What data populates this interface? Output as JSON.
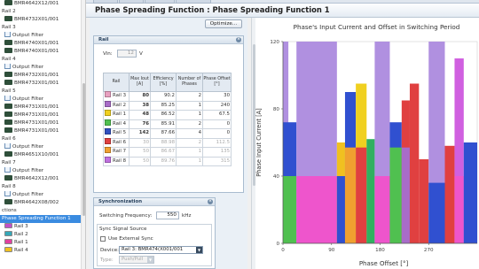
{
  "tree": {
    "items": [
      {
        "label": "BMR4642X12/001",
        "icon": "chip-icon",
        "depth": 1
      },
      {
        "label": "Rail 2",
        "icon": "",
        "depth": 0
      },
      {
        "label": "BMR4732X01/001",
        "icon": "chip-icon",
        "depth": 1
      },
      {
        "label": "Rail 3",
        "icon": "",
        "depth": 0
      },
      {
        "label": "Output Filter",
        "icon": "filter-icon",
        "depth": 1
      },
      {
        "label": "BMR4740X01/001",
        "icon": "chip-icon",
        "depth": 1
      },
      {
        "label": "BMR4740X01/001",
        "icon": "chip-icon",
        "depth": 1
      },
      {
        "label": "Rail 4",
        "icon": "",
        "depth": 0
      },
      {
        "label": "Output Filter",
        "icon": "filter-icon",
        "depth": 1
      },
      {
        "label": "BMR4732X01/001",
        "icon": "chip-icon",
        "depth": 1
      },
      {
        "label": "BMR4732X01/001",
        "icon": "chip-icon",
        "depth": 1
      },
      {
        "label": "Rail 5",
        "icon": "",
        "depth": 0
      },
      {
        "label": "Output Filter",
        "icon": "filter-icon",
        "depth": 1
      },
      {
        "label": "BMR4731X01/001",
        "icon": "chip-icon",
        "depth": 1
      },
      {
        "label": "BMR4731X01/001",
        "icon": "chip-icon",
        "depth": 1
      },
      {
        "label": "BMR4731X01/001",
        "icon": "chip-icon",
        "depth": 1
      },
      {
        "label": "BMR4731X01/001",
        "icon": "chip-icon",
        "depth": 1
      },
      {
        "label": "Rail 6",
        "icon": "",
        "depth": 0
      },
      {
        "label": "Output Filter",
        "icon": "filter-icon",
        "depth": 1
      },
      {
        "label": "BMR4651X10/001",
        "icon": "chip-icon",
        "depth": 1
      },
      {
        "label": "Rail 7",
        "icon": "",
        "depth": 0
      },
      {
        "label": "Output Filter",
        "icon": "filter-icon",
        "depth": 1
      },
      {
        "label": "BMR4642X12/001",
        "icon": "chip-icon",
        "depth": 1
      },
      {
        "label": "Rail 8",
        "icon": "",
        "depth": 0
      },
      {
        "label": "Output Filter",
        "icon": "filter-icon",
        "depth": 1
      },
      {
        "label": "BMR4642X08/002",
        "icon": "chip-icon",
        "depth": 1
      },
      {
        "label": "ctions",
        "icon": "",
        "depth": 0
      },
      {
        "label": "Phase Spreading Function 1",
        "icon": "",
        "depth": 0,
        "selected": true
      },
      {
        "label": "Rail 3",
        "icon": "rail-swatch-icon",
        "depth": 1,
        "color": "#c050c8"
      },
      {
        "label": "Rail 2",
        "icon": "rail-swatch-icon",
        "depth": 1,
        "color": "#35a8b8"
      },
      {
        "label": "Rail 1",
        "icon": "rail-swatch-icon",
        "depth": 1,
        "color": "#e040a0"
      },
      {
        "label": "Rail 4",
        "icon": "rail-swatch-icon",
        "depth": 1,
        "color": "#f0c020"
      }
    ]
  },
  "header": {
    "title": "Phase Spreading Function : Phase Spreading Function 1"
  },
  "toolbar": {
    "optimize_label": "Optimize..."
  },
  "rail_group": {
    "title": "Rail",
    "vin_label": "Vin:",
    "vin_value": "12",
    "vin_unit": "V",
    "columns": [
      "Rail",
      "Max Iout [A]",
      "Efficiency [%]",
      "Number of Phases",
      "Phase Offset [°]"
    ],
    "rows": [
      {
        "name": "Rail 3",
        "color": "#e8a0c0",
        "iout": "80",
        "eff": "90.2",
        "phases": "2",
        "offset": "30",
        "enabled": true
      },
      {
        "name": "Rail 2",
        "color": "#a86cc8",
        "iout": "38",
        "eff": "85.25",
        "phases": "1",
        "offset": "240",
        "enabled": true
      },
      {
        "name": "Rail 1",
        "color": "#f0d020",
        "iout": "48",
        "eff": "86.52",
        "phases": "1",
        "offset": "67.5",
        "enabled": true
      },
      {
        "name": "Rail 4",
        "color": "#50c050",
        "iout": "76",
        "eff": "85.91",
        "phases": "2",
        "offset": "0",
        "enabled": true
      },
      {
        "name": "Rail 5",
        "color": "#3050c0",
        "iout": "142",
        "eff": "87.66",
        "phases": "4",
        "offset": "0",
        "enabled": true
      },
      {
        "name": "Rail 6",
        "color": "#e04040",
        "iout": "30",
        "eff": "88.98",
        "phases": "2",
        "offset": "112.5",
        "enabled": false
      },
      {
        "name": "Rail 7",
        "color": "#f0a030",
        "iout": "50",
        "eff": "86.67",
        "phases": "1",
        "offset": "135",
        "enabled": false
      },
      {
        "name": "Rail 8",
        "color": "#c070e0",
        "iout": "50",
        "eff": "89.76",
        "phases": "1",
        "offset": "315",
        "enabled": false
      }
    ]
  },
  "sync_group": {
    "title": "Synchronization",
    "freq_label": "Switching Frequency:",
    "freq_value": "550",
    "freq_unit": "kHz",
    "source_label": "Sync Signal Source",
    "external_label": "Use External Sync",
    "device_label": "Device:",
    "device_value": "Rail 3: BMR474(X001/001",
    "type_label": "Type:",
    "type_value": "Push/Pull"
  },
  "chart_data": {
    "type": "bar",
    "title": "Phase's Input Current and Offset in Switching Period",
    "xlabel": "Phase Offset [°]",
    "ylabel": "Phase Input Current [A]",
    "xlim": [
      0,
      360
    ],
    "ylim": [
      0,
      120
    ],
    "xticks": [
      "0",
      "90",
      "180",
      "270"
    ],
    "yticks": [
      "0",
      "40",
      "80",
      "120"
    ],
    "bars": [
      {
        "x0": 0,
        "x1": 10,
        "y": 120,
        "color": "#b090e0"
      },
      {
        "x0": 0,
        "x1": 25,
        "y": 72,
        "color": "#3050d0"
      },
      {
        "x0": 0,
        "x1": 25,
        "y": 40,
        "color": "#50c050"
      },
      {
        "x0": 25,
        "x1": 100,
        "y": 120,
        "color": "#b090e0"
      },
      {
        "x0": 25,
        "x1": 100,
        "y": 40,
        "color": "#ee55cc"
      },
      {
        "x0": 100,
        "x1": 115,
        "y": 60,
        "color": "#f0c020"
      },
      {
        "x0": 100,
        "x1": 115,
        "y": 40,
        "color": "#3050d0"
      },
      {
        "x0": 115,
        "x1": 135,
        "y": 90,
        "color": "#3050d0"
      },
      {
        "x0": 115,
        "x1": 135,
        "y": 57,
        "color": "#f0a030"
      },
      {
        "x0": 135,
        "x1": 155,
        "y": 95,
        "color": "#f0d020"
      },
      {
        "x0": 135,
        "x1": 155,
        "y": 57,
        "color": "#e04040"
      },
      {
        "x0": 155,
        "x1": 170,
        "y": 62,
        "color": "#30b060"
      },
      {
        "x0": 170,
        "x1": 198,
        "y": 120,
        "color": "#b090e0"
      },
      {
        "x0": 170,
        "x1": 198,
        "y": 40,
        "color": "#ee55cc"
      },
      {
        "x0": 198,
        "x1": 220,
        "y": 72,
        "color": "#3050d0"
      },
      {
        "x0": 198,
        "x1": 220,
        "y": 57,
        "color": "#50c050"
      },
      {
        "x0": 220,
        "x1": 235,
        "y": 85,
        "color": "#e04040"
      },
      {
        "x0": 220,
        "x1": 235,
        "y": 57,
        "color": "#a86cc8"
      },
      {
        "x0": 235,
        "x1": 252,
        "y": 95,
        "color": "#e04040"
      },
      {
        "x0": 252,
        "x1": 270,
        "y": 50,
        "color": "#e04040"
      },
      {
        "x0": 270,
        "x1": 300,
        "y": 120,
        "color": "#b090e0"
      },
      {
        "x0": 270,
        "x1": 300,
        "y": 36,
        "color": "#3050d0"
      },
      {
        "x0": 300,
        "x1": 318,
        "y": 58,
        "color": "#e04040"
      },
      {
        "x0": 318,
        "x1": 335,
        "y": 110,
        "color": "#d060e0"
      },
      {
        "x0": 318,
        "x1": 335,
        "y": 40,
        "color": "#ee55cc"
      },
      {
        "x0": 335,
        "x1": 360,
        "y": 60,
        "color": "#3050d0"
      }
    ]
  }
}
